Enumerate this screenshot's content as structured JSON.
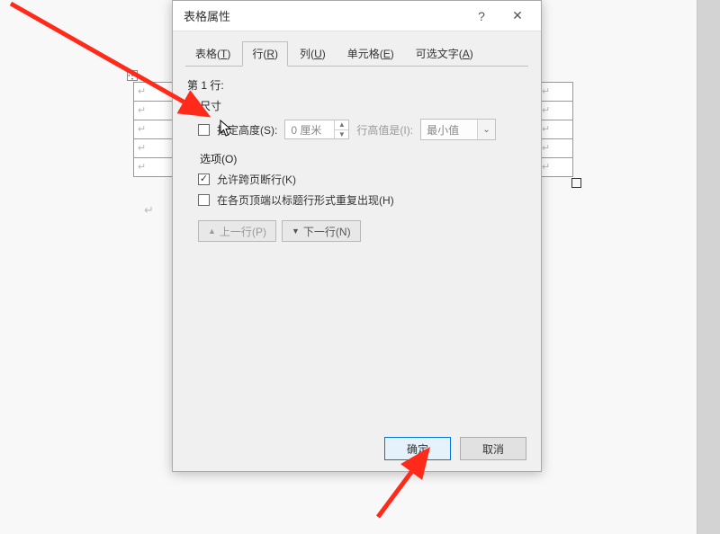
{
  "titlebar": {
    "title": "表格属性",
    "help_label": "?",
    "close_label": "✕"
  },
  "tabs": {
    "table": {
      "label": "表格",
      "accel": "T"
    },
    "row": {
      "label": "行",
      "accel": "R"
    },
    "column": {
      "label": "列",
      "accel": "U"
    },
    "cell": {
      "label": "单元格",
      "accel": "E"
    },
    "alttext": {
      "label": "可选文字",
      "accel": "A"
    }
  },
  "row_tab": {
    "heading": "第 1 行:",
    "size_label": "尺寸",
    "specify_height": {
      "label": "指定高度",
      "accel": "S",
      "checked": false
    },
    "height_value": "0 厘米",
    "height_is_label": "行高值是",
    "height_is_accel": "I",
    "height_rule_value": "最小值",
    "options_label": "选项",
    "options_accel": "O",
    "allow_break": {
      "label": "允许跨页断行",
      "accel": "K",
      "checked": true
    },
    "repeat_header": {
      "label": "在各页顶端以标题行形式重复出现",
      "accel": "H",
      "checked": false
    },
    "prev_row": {
      "label": "上一行",
      "accel": "P"
    },
    "next_row": {
      "label": "下一行",
      "accel": "N"
    }
  },
  "footer": {
    "ok": "确定",
    "cancel": "取消"
  },
  "bg": {
    "cell_mark": "↵"
  }
}
